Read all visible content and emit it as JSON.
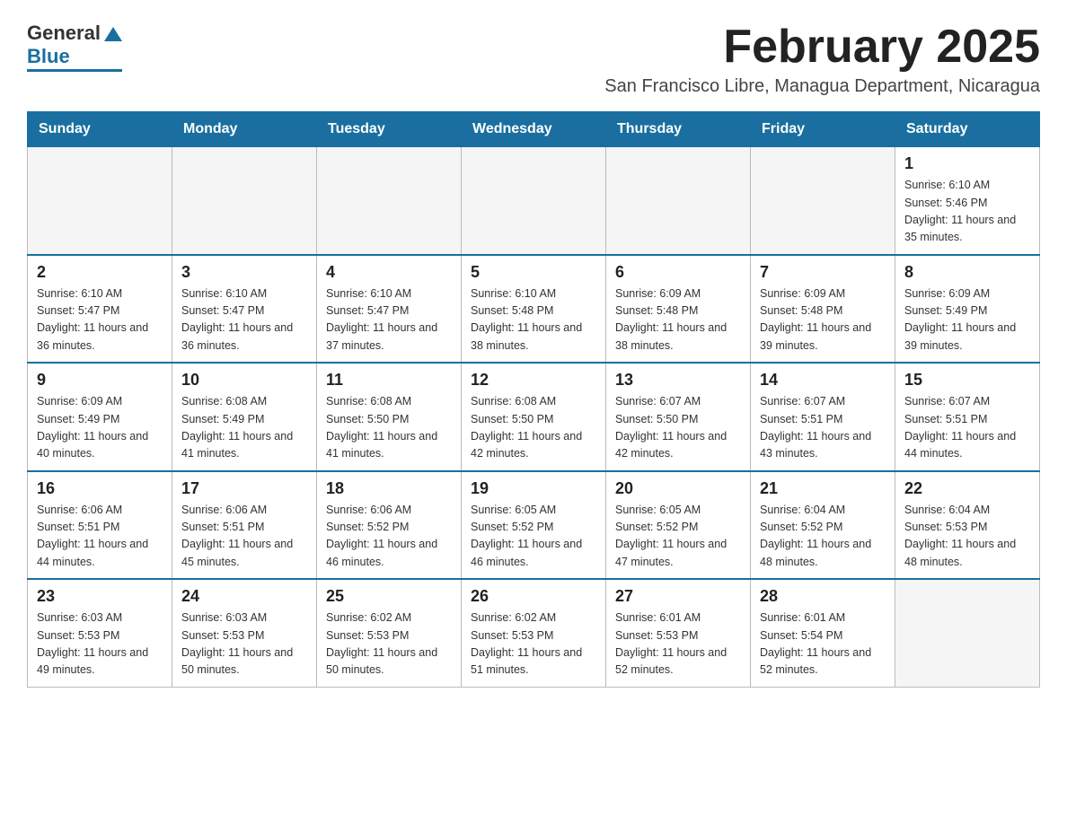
{
  "header": {
    "logo_general": "General",
    "logo_blue": "Blue",
    "title": "February 2025",
    "location": "San Francisco Libre, Managua Department, Nicaragua"
  },
  "days_of_week": [
    "Sunday",
    "Monday",
    "Tuesday",
    "Wednesday",
    "Thursday",
    "Friday",
    "Saturday"
  ],
  "weeks": [
    [
      {
        "date": "",
        "info": ""
      },
      {
        "date": "",
        "info": ""
      },
      {
        "date": "",
        "info": ""
      },
      {
        "date": "",
        "info": ""
      },
      {
        "date": "",
        "info": ""
      },
      {
        "date": "",
        "info": ""
      },
      {
        "date": "1",
        "info": "Sunrise: 6:10 AM\nSunset: 5:46 PM\nDaylight: 11 hours and 35 minutes."
      }
    ],
    [
      {
        "date": "2",
        "info": "Sunrise: 6:10 AM\nSunset: 5:47 PM\nDaylight: 11 hours and 36 minutes."
      },
      {
        "date": "3",
        "info": "Sunrise: 6:10 AM\nSunset: 5:47 PM\nDaylight: 11 hours and 36 minutes."
      },
      {
        "date": "4",
        "info": "Sunrise: 6:10 AM\nSunset: 5:47 PM\nDaylight: 11 hours and 37 minutes."
      },
      {
        "date": "5",
        "info": "Sunrise: 6:10 AM\nSunset: 5:48 PM\nDaylight: 11 hours and 38 minutes."
      },
      {
        "date": "6",
        "info": "Sunrise: 6:09 AM\nSunset: 5:48 PM\nDaylight: 11 hours and 38 minutes."
      },
      {
        "date": "7",
        "info": "Sunrise: 6:09 AM\nSunset: 5:48 PM\nDaylight: 11 hours and 39 minutes."
      },
      {
        "date": "8",
        "info": "Sunrise: 6:09 AM\nSunset: 5:49 PM\nDaylight: 11 hours and 39 minutes."
      }
    ],
    [
      {
        "date": "9",
        "info": "Sunrise: 6:09 AM\nSunset: 5:49 PM\nDaylight: 11 hours and 40 minutes."
      },
      {
        "date": "10",
        "info": "Sunrise: 6:08 AM\nSunset: 5:49 PM\nDaylight: 11 hours and 41 minutes."
      },
      {
        "date": "11",
        "info": "Sunrise: 6:08 AM\nSunset: 5:50 PM\nDaylight: 11 hours and 41 minutes."
      },
      {
        "date": "12",
        "info": "Sunrise: 6:08 AM\nSunset: 5:50 PM\nDaylight: 11 hours and 42 minutes."
      },
      {
        "date": "13",
        "info": "Sunrise: 6:07 AM\nSunset: 5:50 PM\nDaylight: 11 hours and 42 minutes."
      },
      {
        "date": "14",
        "info": "Sunrise: 6:07 AM\nSunset: 5:51 PM\nDaylight: 11 hours and 43 minutes."
      },
      {
        "date": "15",
        "info": "Sunrise: 6:07 AM\nSunset: 5:51 PM\nDaylight: 11 hours and 44 minutes."
      }
    ],
    [
      {
        "date": "16",
        "info": "Sunrise: 6:06 AM\nSunset: 5:51 PM\nDaylight: 11 hours and 44 minutes."
      },
      {
        "date": "17",
        "info": "Sunrise: 6:06 AM\nSunset: 5:51 PM\nDaylight: 11 hours and 45 minutes."
      },
      {
        "date": "18",
        "info": "Sunrise: 6:06 AM\nSunset: 5:52 PM\nDaylight: 11 hours and 46 minutes."
      },
      {
        "date": "19",
        "info": "Sunrise: 6:05 AM\nSunset: 5:52 PM\nDaylight: 11 hours and 46 minutes."
      },
      {
        "date": "20",
        "info": "Sunrise: 6:05 AM\nSunset: 5:52 PM\nDaylight: 11 hours and 47 minutes."
      },
      {
        "date": "21",
        "info": "Sunrise: 6:04 AM\nSunset: 5:52 PM\nDaylight: 11 hours and 48 minutes."
      },
      {
        "date": "22",
        "info": "Sunrise: 6:04 AM\nSunset: 5:53 PM\nDaylight: 11 hours and 48 minutes."
      }
    ],
    [
      {
        "date": "23",
        "info": "Sunrise: 6:03 AM\nSunset: 5:53 PM\nDaylight: 11 hours and 49 minutes."
      },
      {
        "date": "24",
        "info": "Sunrise: 6:03 AM\nSunset: 5:53 PM\nDaylight: 11 hours and 50 minutes."
      },
      {
        "date": "25",
        "info": "Sunrise: 6:02 AM\nSunset: 5:53 PM\nDaylight: 11 hours and 50 minutes."
      },
      {
        "date": "26",
        "info": "Sunrise: 6:02 AM\nSunset: 5:53 PM\nDaylight: 11 hours and 51 minutes."
      },
      {
        "date": "27",
        "info": "Sunrise: 6:01 AM\nSunset: 5:53 PM\nDaylight: 11 hours and 52 minutes."
      },
      {
        "date": "28",
        "info": "Sunrise: 6:01 AM\nSunset: 5:54 PM\nDaylight: 11 hours and 52 minutes."
      },
      {
        "date": "",
        "info": ""
      }
    ]
  ]
}
